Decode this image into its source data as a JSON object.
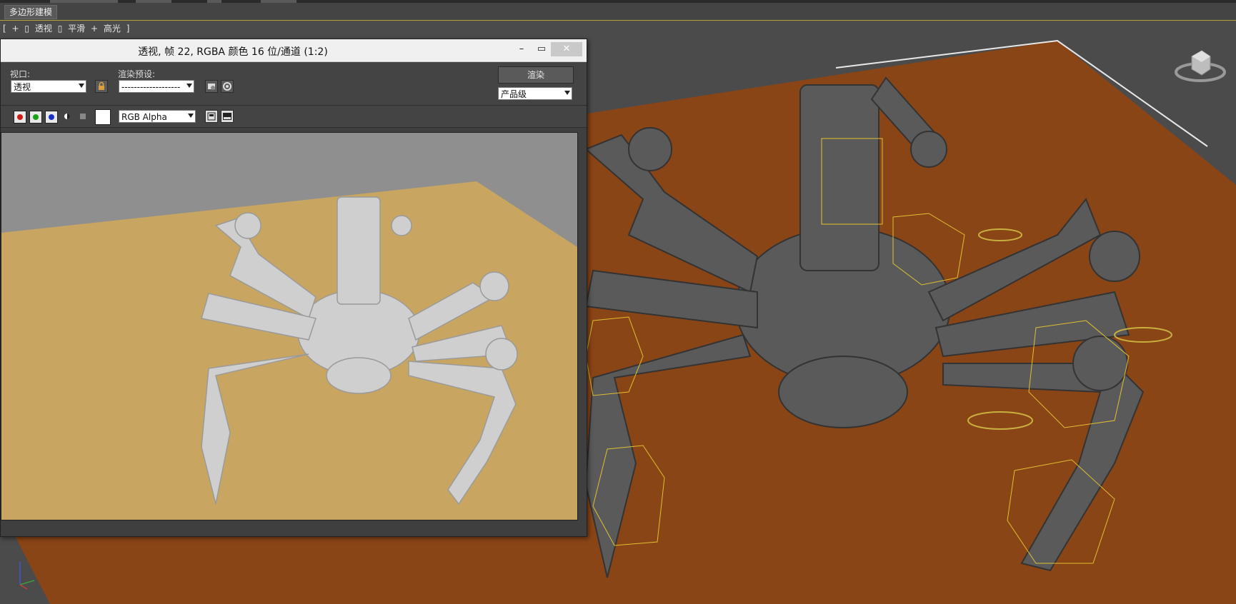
{
  "ribbon": {
    "active_tab": "多边形建模"
  },
  "viewport": {
    "label_parts": [
      "[",
      "+",
      "▯",
      "透视",
      "▯",
      "平滑",
      "+",
      "高光",
      "]"
    ]
  },
  "render_window": {
    "title": "透视, 帧 22, RGBA 颜色 16 位/通道 (1:2)",
    "minimize_glyph": "–",
    "maximize_glyph": "▭",
    "close_glyph": "✕",
    "viewport_label": "视口:",
    "viewport_value": "透视",
    "preset_label": "渲染预设:",
    "preset_value": "-------------------",
    "render_button": "渲染",
    "quality_value": "产品级",
    "channel_value": "RGB Alpha"
  },
  "colors": {
    "floor_viewport": "#8a4516",
    "floor_render": "#c8a662",
    "model_viewport": "#5a5a5a",
    "model_render": "#cfcfcf",
    "selection_box": "#e0c030"
  }
}
